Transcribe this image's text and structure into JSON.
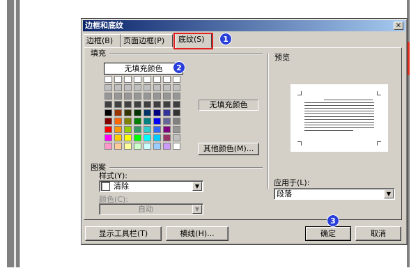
{
  "dialog": {
    "title": "边框和底纹",
    "close": "×"
  },
  "tabs": [
    {
      "label": "边框(B)"
    },
    {
      "label": "页面边框(P)"
    },
    {
      "label": "底纹(S)"
    }
  ],
  "fill": {
    "section_label": "填充",
    "no_fill": "无填充颜色",
    "preview_label": "无填充颜色",
    "more_colors": "其他颜色(M)...",
    "palette": [
      [
        "#ffffff",
        "#ffffff",
        "#ffffff",
        "#ffffff",
        "#ffffff",
        "#ffffff",
        "#ffffff",
        "#ffffff"
      ],
      [
        "#c0c0c0",
        "#c0c0c0",
        "#c0c0c0",
        "#c0c0c0",
        "#c0c0c0",
        "#c0c0c0",
        "#c0c0c0",
        "#c0c0c0"
      ],
      [
        "#969696",
        "#969696",
        "#969696",
        "#969696",
        "#969696",
        "#969696",
        "#969696",
        "#969696"
      ],
      [
        "#404040",
        "#404040",
        "#404040",
        "#404040",
        "#404040",
        "#404040",
        "#404040",
        "#404040"
      ],
      [
        "#000000",
        "#993300",
        "#333300",
        "#003300",
        "#003366",
        "#000080",
        "#333399",
        "#333333"
      ],
      [
        "#800000",
        "#ff6600",
        "#808000",
        "#008000",
        "#008080",
        "#0000ff",
        "#666699",
        "#808080"
      ],
      [
        "#ff0000",
        "#ff9900",
        "#99cc00",
        "#339966",
        "#33cccc",
        "#3366ff",
        "#800080",
        "#969696"
      ],
      [
        "#ff00ff",
        "#ffcc00",
        "#ffff00",
        "#00ff00",
        "#00ffff",
        "#00ccff",
        "#993366",
        "#c0c0c0"
      ],
      [
        "#ff99cc",
        "#ffcc99",
        "#ffff99",
        "#ccffcc",
        "#ccffff",
        "#99ccff",
        "#cc99ff",
        "#ffffff"
      ]
    ]
  },
  "pattern": {
    "section_label": "图案",
    "style_label": "样式(Y):",
    "style_value": "清除",
    "color_label": "颜色(C):",
    "color_value": "自动"
  },
  "preview": {
    "section_label": "预览"
  },
  "apply": {
    "label": "应用于(L):",
    "value": "段落"
  },
  "buttons": {
    "show_toolbar": "显示工具栏(T)",
    "horizontal_line": "横线(H)...",
    "ok": "确定",
    "cancel": "取消"
  },
  "badges": [
    "1",
    "2",
    "3"
  ],
  "colors": {
    "highlight": "#e02020",
    "badge": "#2a3fd9",
    "dialog_bg": "#d4d0c8"
  }
}
